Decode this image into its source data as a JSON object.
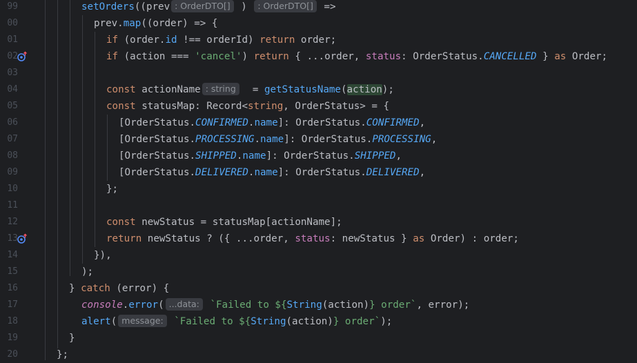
{
  "editor": {
    "line_numbers": [
      "99",
      "00",
      "01",
      "02",
      "03",
      "04",
      "05",
      "06",
      "07",
      "08",
      "09",
      "10",
      "11",
      "12",
      "13",
      "14",
      "15",
      "16",
      "17",
      "18",
      "19",
      "20"
    ],
    "hints": {
      "prev_type": ": OrderDTO[]",
      "return_type": ": OrderDTO[]",
      "action_name_type": ": string",
      "data_param": "...data:",
      "message_param": "message:"
    },
    "code": {
      "set_orders": "setOrders",
      "paren_prev": "((prev",
      "close_paren": ")",
      "arrow_tail": " =>",
      "l100_prev": "prev.",
      "l100_map": "map",
      "l100_rest": "((order) => {",
      "l101_if": "if",
      "l101_a": " (order.",
      "l101_id": "id",
      "l101_b": " !== orderId) ",
      "l101_return": "return",
      "l101_c": " order;",
      "l102_if": "if",
      "l102_a": " (action === ",
      "l102_str": "'cancel'",
      "l102_b": ") ",
      "l102_return": "return",
      "l102_c": " { ...order, ",
      "l102_status": "status",
      "l102_d": ": OrderStatus.",
      "l102_cancelled": "CANCELLED",
      "l102_e": " } ",
      "l102_as": "as",
      "l102_f": " Order;",
      "l104_const": "const",
      "l104_name": " actionName",
      "l104_eq": " = ",
      "l104_fn": "getStatusName",
      "l104_open": "(",
      "l104_action": "action",
      "l104_close": ");",
      "l105_const": "const",
      "l105_a": " statusMap: Record<",
      "l105_string": "string",
      "l105_b": ", OrderStatus> = {",
      "l106_a": "[OrderStatus.",
      "l106_e1": "CONFIRMED",
      "l106_dot": ".",
      "l106_name": "name",
      "l106_b": "]: OrderStatus.",
      "l106_e2": "CONFIRMED",
      "l106_c": ",",
      "l107_a": "[OrderStatus.",
      "l107_e1": "PROCESSING",
      "l107_dot": ".",
      "l107_name": "name",
      "l107_b": "]: OrderStatus.",
      "l107_e2": "PROCESSING",
      "l107_c": ",",
      "l108_a": "[OrderStatus.",
      "l108_e1": "SHIPPED",
      "l108_dot": ".",
      "l108_name": "name",
      "l108_b": "]: OrderStatus.",
      "l108_e2": "SHIPPED",
      "l108_c": ",",
      "l109_a": "[OrderStatus.",
      "l109_e1": "DELIVERED",
      "l109_dot": ".",
      "l109_name": "name",
      "l109_b": "]: OrderStatus.",
      "l109_e2": "DELIVERED",
      "l109_c": ",",
      "l110": "};",
      "l112_const": "const",
      "l112_rest": " newStatus = statusMap[actionName];",
      "l113_return": "return",
      "l113_a": " newStatus ? ({ ...order, ",
      "l113_status": "status",
      "l113_b": ": newStatus } ",
      "l113_as": "as",
      "l113_c": " Order) : order;",
      "l114": "}),",
      "l115": ");",
      "l116_a": "} ",
      "l116_catch": "catch",
      "l116_b": " (error) {",
      "l117_console": "console",
      "l117_dot": ".",
      "l117_error": "error",
      "l117_open": "(",
      "l117_str1": "`Failed to ${",
      "l117_String": "String",
      "l117_mid": "(action)",
      "l117_str2": "} order`",
      "l117_rest": ", error);",
      "l118_alert": "alert",
      "l118_open": "(",
      "l118_str1": "`Failed to ${",
      "l118_String": "String",
      "l118_mid": "(action)",
      "l118_str2": "} order`",
      "l118_rest": ");",
      "l119": "}",
      "l120": "};"
    }
  }
}
